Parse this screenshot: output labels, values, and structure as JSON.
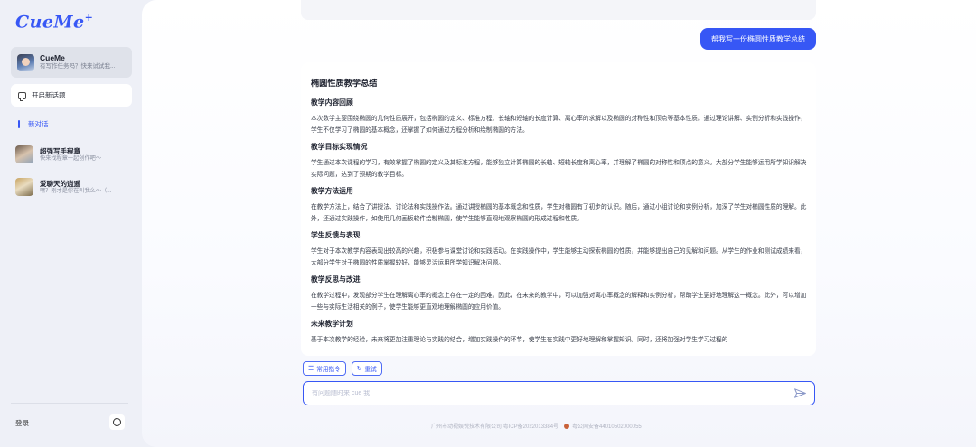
{
  "sidebar": {
    "logo": "CueMe",
    "logo_mark": "+",
    "agent": {
      "name": "CueMe",
      "subtitle": "有写作任务吗？快来试试我..."
    },
    "new_topic_label": "开启新话题",
    "active_conversation": "新对话",
    "bots": [
      {
        "name": "超强写手程章",
        "subtitle": "快来找程章一起创作吧～"
      },
      {
        "name": "爱聊天的逍遥",
        "subtitle": "嘿？刚才是你在叫我么～（..."
      }
    ],
    "login_label": "登录",
    "info_icon": "ⓘ"
  },
  "chat": {
    "user_message": "帮我写一份椭圆性质教学总结",
    "answer_title": "椭圆性质教学总结",
    "sections": [
      {
        "heading": "教学内容回顾",
        "text": "本次数学主要围绕椭圆的几何性质展开，包括椭圆的定义、标准方程、长轴和短轴的长度计算、离心率的求解以及椭圆的对称性和顶点等基本性质。通过理论讲解、实例分析和实践操作，学生不仅学习了椭圆的基本概念，还掌握了如何通过方程分析和绘制椭圆的方法。"
      },
      {
        "heading": "教学目标实现情况",
        "text": "学生通过本次课程的学习，有效掌握了椭圆的定义及其标准方程，能够独立计算椭圆的长轴、短轴长度和离心率，并理解了椭圆的对称性和顶点的意义。大部分学生能够运用所学知识解决实际问题，达到了预期的教学目标。"
      },
      {
        "heading": "教学方法运用",
        "text": "在教学方法上，结合了讲授法、讨论法和实践操作法。通过讲授椭圆的基本概念和性质，学生对椭圆有了初步的认识。随后，通过小组讨论和实例分析，加深了学生对椭圆性质的理解。此外，还通过实践操作，如使用几何画板软件绘制椭圆，使学生能够直观地观察椭圆的形成过程和性质。"
      },
      {
        "heading": "学生反馈与表现",
        "text": "学生对于本次教学内容表现出较高的兴趣，积极参与课堂讨论和实践活动。在实践操作中，学生能够主动探索椭圆的性质，并能够提出自己的见解和问题。从学生的作业和测试成绩来看，大部分学生对于椭圆的性质掌握较好，能够灵活运用所学知识解决问题。"
      },
      {
        "heading": "教学反思与改进",
        "text": "在教学过程中，发现部分学生在理解离心率的概念上存在一定的困难。因此，在未来的教学中，可以加强对离心率概念的解释和实例分析，帮助学生更好地理解这一概念。此外，可以增加一些与实际生活相关的例子，使学生能够更直观地理解椭圆的应用价值。"
      },
      {
        "heading": "未来教学计划",
        "text": "基于本次教学的经验，未来将更加注重理论与实践的结合，增加实践操作的环节，使学生在实践中更好地理解和掌握知识。同时，还将加强对学生学习过程的"
      }
    ],
    "chips": [
      {
        "icon": "☰",
        "label": "常用指令"
      },
      {
        "icon": "↻",
        "label": "重试"
      }
    ],
    "input_placeholder": "有问题随时来 cue 我",
    "footer_company": "广州市动视娱悦技术有限公司 粤ICP备2022013384号",
    "footer_police": "粤公网安备44010502000055"
  },
  "colors": {
    "accent": "#3757f5"
  }
}
